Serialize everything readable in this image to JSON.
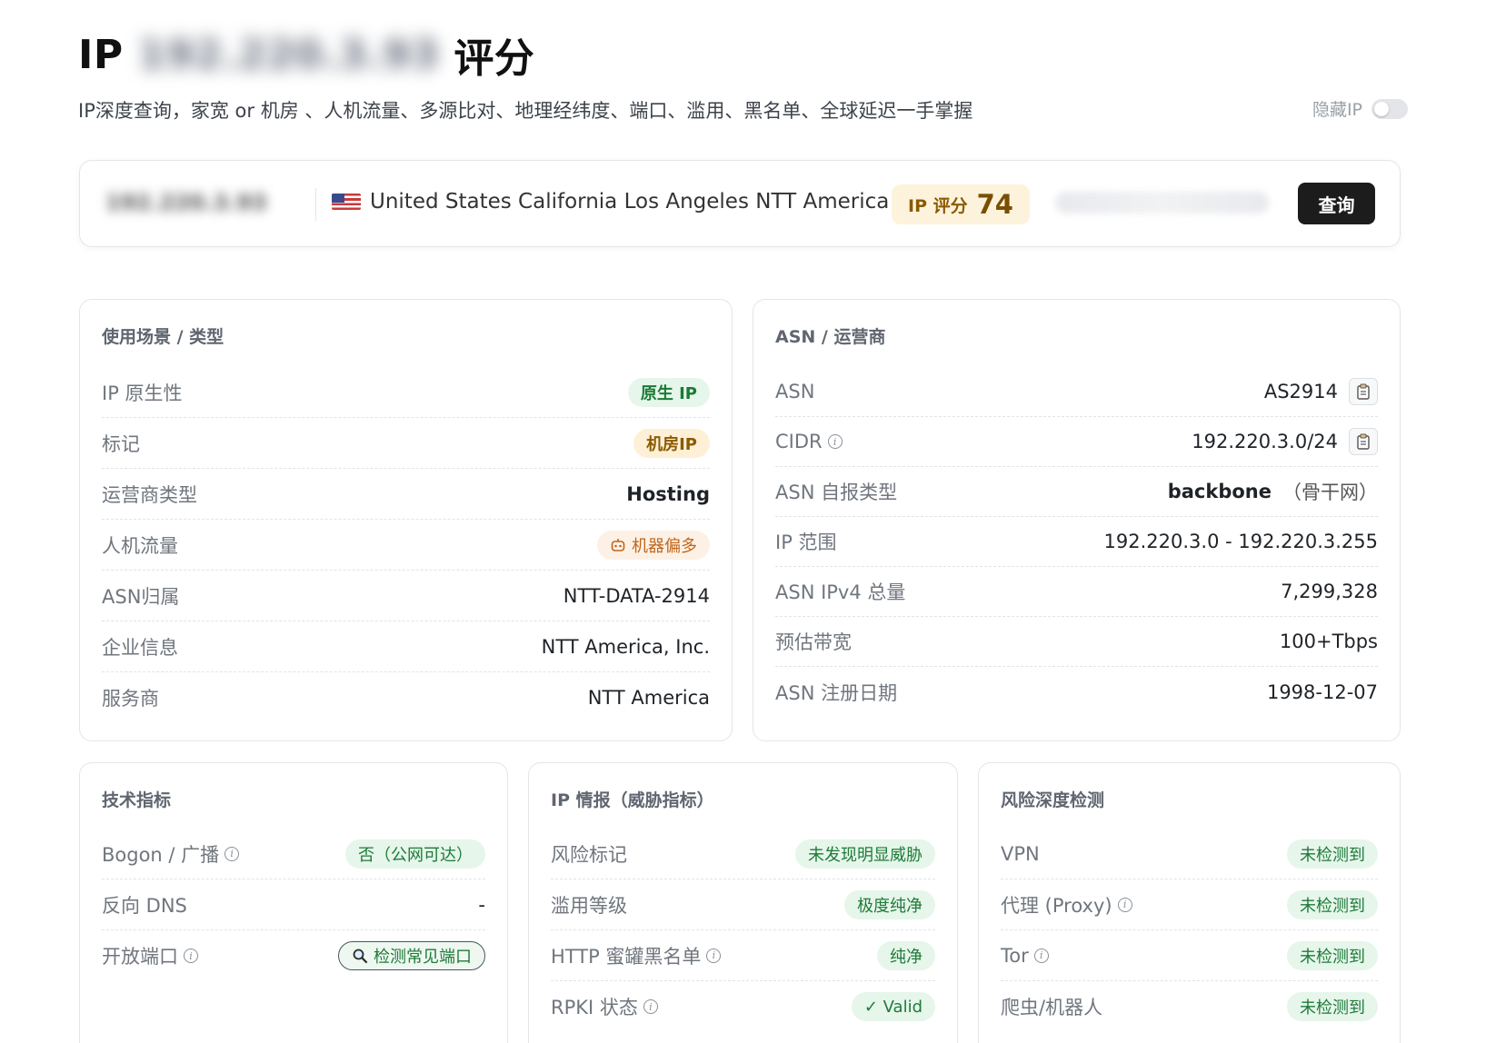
{
  "header": {
    "title_prefix": "IP",
    "title_ip": "192.220.3.93",
    "title_suffix": "评分",
    "subtitle": "IP深度查询，家宽 or 机房 、人机流量、多源比对、地理经纬度、端口、滥用、黑名单、全球延迟一手掌握",
    "hide_ip_label": "隐藏IP"
  },
  "query_bar": {
    "ip": "192.220.3.93",
    "location": "United States California Los Angeles NTT America",
    "score_label": "IP 评分",
    "score_value": "74",
    "query_button": "查询"
  },
  "usage_card": {
    "title": "使用场景 / 类型",
    "rows": [
      {
        "label": "IP 原生性",
        "value": "原生 IP"
      },
      {
        "label": "标记",
        "value": "机房IP"
      },
      {
        "label": "运营商类型",
        "value": "Hosting"
      },
      {
        "label": "人机流量",
        "value": "机器偏多"
      },
      {
        "label": "ASN归属",
        "value": "NTT-DATA-2914"
      },
      {
        "label": "企业信息",
        "value": "NTT America, Inc."
      },
      {
        "label": "服务商",
        "value": "NTT America"
      }
    ]
  },
  "asn_card": {
    "title": "ASN / 运营商",
    "rows": [
      {
        "label": "ASN",
        "value": "AS2914"
      },
      {
        "label": "CIDR",
        "value": "192.220.3.0/24"
      },
      {
        "label": "ASN 自报类型",
        "value": "backbone",
        "note": "（骨干网）"
      },
      {
        "label": "IP 范围",
        "value": "192.220.3.0 - 192.220.3.255"
      },
      {
        "label": "ASN IPv4 总量",
        "value": "7,299,328"
      },
      {
        "label": "预估带宽",
        "value": "100+Tbps"
      },
      {
        "label": "ASN 注册日期",
        "value": "1998-12-07"
      }
    ]
  },
  "tech_card": {
    "title": "技术指标",
    "rows": [
      {
        "label": "Bogon / 广播",
        "value": "否（公网可达）"
      },
      {
        "label": "反向 DNS",
        "value": "-"
      },
      {
        "label": "开放端口",
        "value": "检测常见端口"
      }
    ]
  },
  "intel_card": {
    "title": "IP 情报（威胁指标）",
    "rows": [
      {
        "label": "风险标记",
        "value": "未发现明显威胁"
      },
      {
        "label": "滥用等级",
        "value": "极度纯净"
      },
      {
        "label": "HTTP 蜜罐黑名单",
        "value": "纯净"
      },
      {
        "label": "RPKI 状态",
        "value": "✓ Valid"
      }
    ]
  },
  "risk_card": {
    "title": "风险深度检测",
    "rows": [
      {
        "label": "VPN",
        "value": "未检测到"
      },
      {
        "label": "代理 (Proxy)",
        "value": "未检测到"
      },
      {
        "label": "Tor",
        "value": "未检测到"
      },
      {
        "label": "爬虫/机器人",
        "value": "未检测到"
      }
    ]
  },
  "colors": {
    "accent_dark": "#1c1c1c",
    "green_text": "#1e7a3a",
    "green_bg": "#e6f6ea",
    "amber_text": "#8a5a00",
    "amber_bg": "#fdf0d6",
    "orange_text": "#c0651a"
  }
}
